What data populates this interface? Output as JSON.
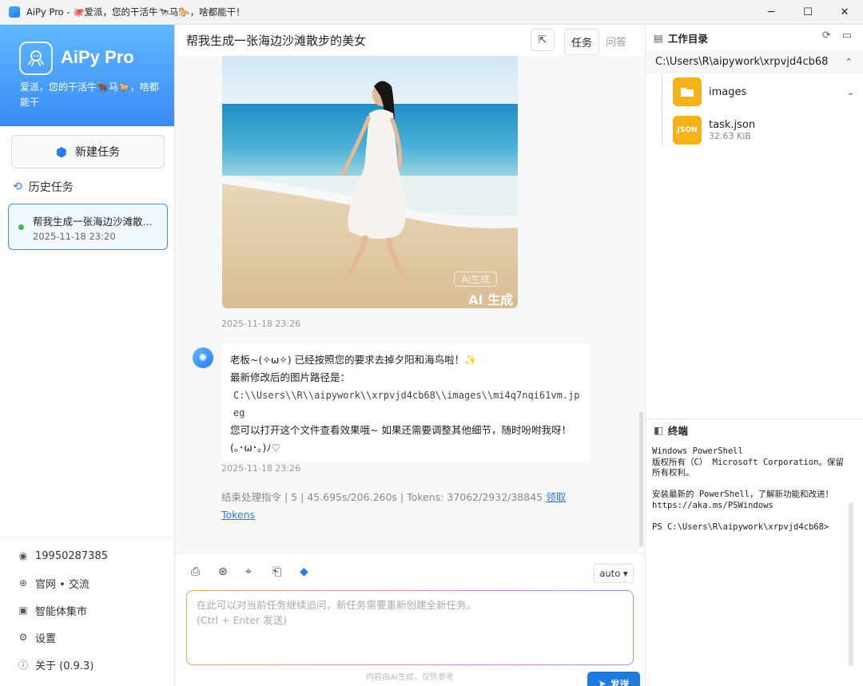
{
  "window": {
    "title": "AiPy Pro - 🐙爱派，您的干活牛🐄马🐎，啥都能干！",
    "min": "─",
    "max": "☐",
    "close": "✕"
  },
  "sidebar": {
    "brand_name": "AiPy Pro",
    "slogan": "爱派，您的干活牛🐂马🐎，啥都能干",
    "new_task_label": "新建任务",
    "history_label": "历史任务",
    "task": {
      "title": "帮我生成一张海边沙滩散...",
      "date": "2025-11-18 23:20"
    },
    "links": [
      {
        "icon": "user-icon",
        "label": "19950287385"
      },
      {
        "icon": "globe-icon",
        "label": "官网 • 交流"
      },
      {
        "icon": "agent-market-icon",
        "label": "智能体集市"
      },
      {
        "icon": "settings-icon",
        "label": "设置"
      },
      {
        "icon": "info-icon",
        "label": "关于 (0.9.3)"
      }
    ]
  },
  "chat": {
    "title": "帮我生成一张海边沙滩散步的美女",
    "tabs": [
      "任务",
      "问答"
    ],
    "image_watermark_1": "AI生成",
    "image_watermark_2": "AI 生成",
    "timestamp_1": "2025-11-18 23:26",
    "message": {
      "line1": "老板~(✧ω✧) 已经按照您的要求去掉夕阳和海鸟啦！✨",
      "line2": "最新修改后的图片路径是：",
      "path": "C:\\\\Users\\\\R\\\\aipywork\\\\xrpvjd4cb68\\\\images\\\\mi4q7nqi61vm.jpeg",
      "line3": "您可以打开这个文件查看效果哦~ 如果还需要调整其他细节，随时吩咐我呀！",
      "line4": "(｡･ω･｡)ﾉ♡"
    },
    "timestamp_2": "2025-11-18 23:26",
    "stats_text": "结束处理指令 | 5 | 45.695s/206.260s | Tokens: 37062/2932/38845",
    "stats_link": "领取Tokens"
  },
  "composer": {
    "model": "auto ▾",
    "placeholder_1": "在此可以对当前任务继续追问，新任务需要重新创建全新任务。",
    "placeholder_2": "(Ctrl + Enter 发送)",
    "send_label": "发送",
    "disclaimer": "内容由AI生成，仅供参考"
  },
  "workspace": {
    "title": "工作目录",
    "path": "C:\\Users\\R\\aipywork\\xrpvjd4cb68",
    "folder": "images",
    "file": {
      "name": "task.json",
      "size": "32.63 KiB",
      "badge": "JSON"
    }
  },
  "terminal": {
    "title": "终端",
    "content": "Windows PowerShell\n版权所有（C） Microsoft Corporation。保留所有权利。\n\n安装最新的 PowerShell，了解新功能和改进！https://aka.ms/PSWindows\n\nPS C:\\Users\\R\\aipywork\\xrpvjd4cb68>"
  }
}
